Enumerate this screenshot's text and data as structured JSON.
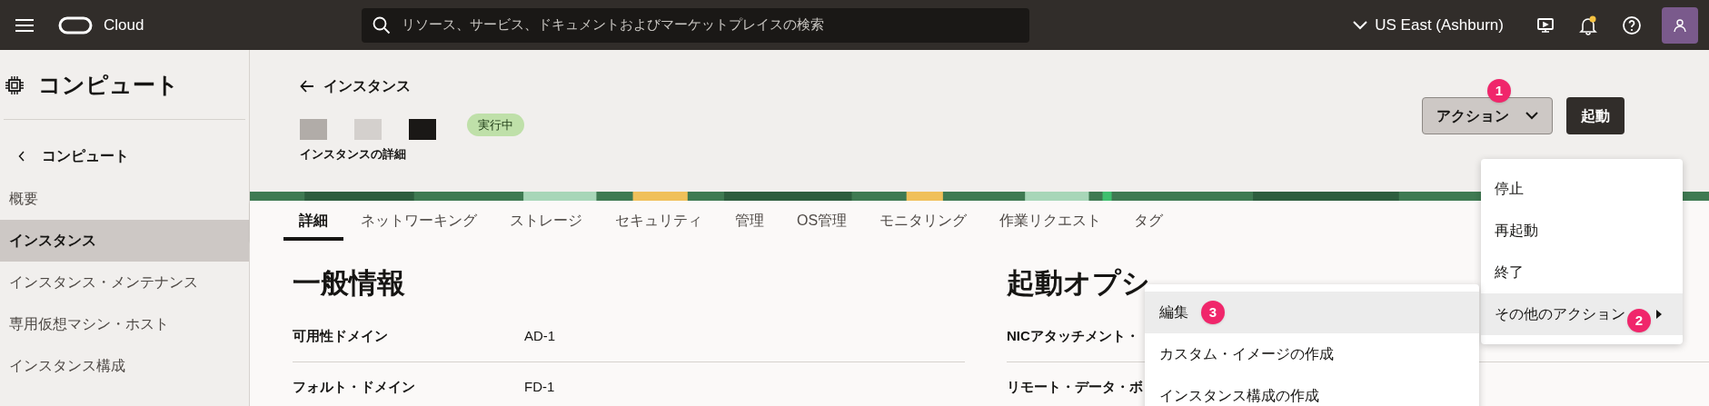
{
  "topbar": {
    "brand": "Cloud",
    "search": {
      "placeholder": "リソース、サービス、ドキュメントおよびマーケットプレイスの検索"
    },
    "region": "US East (Ashburn)"
  },
  "sidebar": {
    "title": "コンピュート",
    "back": "コンピュート",
    "items": [
      {
        "label": "概要",
        "selected": false
      },
      {
        "label": "インスタンス",
        "selected": true
      },
      {
        "label": "インスタンス・メンテナンス",
        "selected": false
      },
      {
        "label": "専用仮想マシン・ホスト",
        "selected": false
      },
      {
        "label": "インスタンス構成",
        "selected": false
      }
    ]
  },
  "header": {
    "back_link": "インスタンス",
    "subtitle": "インスタンスの詳細",
    "status": "実行中",
    "actions_button": {
      "label": "アクション",
      "step": "1"
    },
    "start_button": "起動"
  },
  "tabs": [
    {
      "label": "詳細",
      "selected": true
    },
    {
      "label": "ネットワーキング",
      "selected": false
    },
    {
      "label": "ストレージ",
      "selected": false
    },
    {
      "label": "セキュリティ",
      "selected": false
    },
    {
      "label": "管理",
      "selected": false
    },
    {
      "label": "OS管理",
      "selected": false
    },
    {
      "label": "モニタリング",
      "selected": false
    },
    {
      "label": "作業リクエスト",
      "selected": false
    },
    {
      "label": "タグ",
      "selected": false
    }
  ],
  "general": {
    "title": "一般情報",
    "rows": [
      {
        "label": "可用性ドメイン",
        "value": "AD-1"
      },
      {
        "label": "フォルト・ドメイン",
        "value": "FD-1"
      }
    ]
  },
  "launch_options": {
    "title": "起動オプシ",
    "rows": [
      {
        "label": "NICアタッチメント・"
      },
      {
        "label": "リモート・データ・ボ"
      }
    ]
  },
  "actions_menu": {
    "items": [
      {
        "label": "停止",
        "kind": "item",
        "selected": false
      },
      {
        "label": "再起動",
        "kind": "item",
        "selected": false
      },
      {
        "label": "終了",
        "kind": "item",
        "selected": false
      },
      {
        "label": "その他のアクション",
        "kind": "submenu",
        "selected": true,
        "step": "2"
      }
    ]
  },
  "submenu": {
    "items": [
      {
        "label": "編集",
        "selected": true,
        "step": "3"
      },
      {
        "label": "カスタム・イメージの作成",
        "selected": false
      },
      {
        "label": "インスタンス構成の作成",
        "selected": false
      }
    ]
  }
}
